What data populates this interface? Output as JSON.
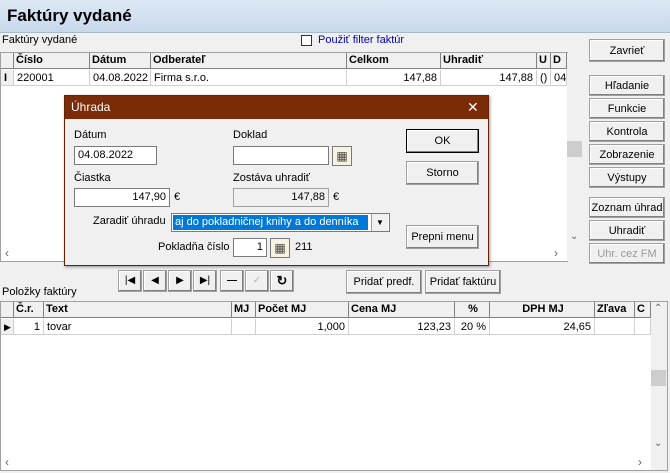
{
  "window": {
    "title": "Faktúry vydané"
  },
  "invoices": {
    "label": "Faktúry vydané",
    "filter_checkbox": "Použiť filter faktúr",
    "columns": [
      "Číslo",
      "Dátum",
      "Odberateľ",
      "Celkom",
      "Uhradiť",
      "U",
      "D"
    ],
    "rows": [
      {
        "marker": "I",
        "cislo": "220001",
        "datum": "04.08.2022",
        "odberatel": "Firma s.r.o.",
        "celkom": "147,88",
        "uhradit": "147,88",
        "u": "()",
        "d": "04"
      }
    ]
  },
  "right_buttons": {
    "zavriet": "Zavrieť",
    "hladanie": "Hľadanie",
    "funkcie": "Funkcie",
    "kontrola": "Kontrola",
    "zobrazenie": "Zobrazenie",
    "vystupy": "Výstupy",
    "zoznam_uhrad": "Zoznam úhrad",
    "uhradit": "Uhradiť",
    "uhr_cez_fm": "Uhr. cez FM"
  },
  "nav_buttons": {
    "first": "|◀",
    "prev": "◀",
    "next": "▶",
    "last": "▶|",
    "delete": "—",
    "edit": "✓",
    "refresh": "↻"
  },
  "middle_buttons": {
    "pridat_predf": "Pridať predf.",
    "pridat_fakturu": "Pridať faktúru"
  },
  "items": {
    "label": "Položky faktúry",
    "columns": [
      "Č.r.",
      "Text",
      "MJ",
      "Počet MJ",
      "Cena MJ",
      "%",
      "DPH MJ",
      "Zľava",
      "C"
    ],
    "rows": [
      {
        "cr": "1",
        "text": "tovar",
        "mj": "",
        "pocet": "1,000",
        "cena": "123,23",
        "pct": "20 %",
        "dph": "24,65",
        "zlava": "",
        "c": ""
      }
    ]
  },
  "dialog": {
    "title": "Úhrada",
    "datum_label": "Dátum",
    "datum_value": "04.08.2022",
    "doklad_label": "Doklad",
    "doklad_value": "",
    "ciastka_label": "Čiastka",
    "ciastka_value": "147,90",
    "ciastka_currency": "€",
    "zostava_label": "Zostáva uhradiť",
    "zostava_value": "147,88",
    "zostava_currency": "€",
    "zaradit_label": "Zaradiť úhradu",
    "zaradit_value": "aj do pokladničnej knihy a do denníka",
    "pokladna_label": "Pokladňa číslo",
    "pokladna_value": "1",
    "pokladna_extra": "211",
    "ok_label": "OK",
    "storno_label": "Storno",
    "prepni_label": "Prepni menu",
    "close_glyph": "✕"
  }
}
